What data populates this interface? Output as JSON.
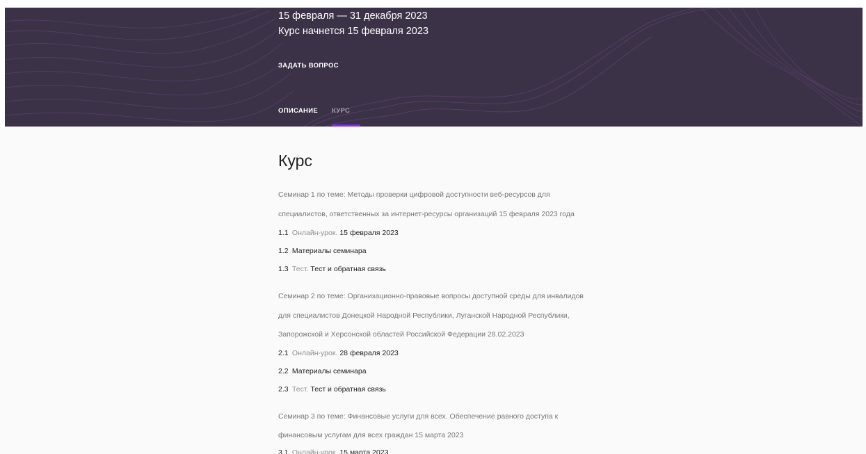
{
  "hero": {
    "dates": "15 февраля — 31 декабря 2023",
    "start": "Курс начнется 15 февраля 2023",
    "ask_label": "ЗАДАТЬ ВОПРОС",
    "tabs": [
      {
        "label": "ОПИСАНИЕ"
      },
      {
        "label": "КУРС"
      }
    ],
    "active_tab": "КУРС"
  },
  "course": {
    "heading": "Курс",
    "seminars": [
      {
        "lines": [
          "Семинар 1 по теме: Методы проверки цифровой доступности веб-ресурсов для",
          "специалистов, ответственных за интернет-ресурсы организаций 15 февраля 2023 года"
        ],
        "items": [
          {
            "num": "1.1",
            "kind": "Онлайн-урок.",
            "title": "15 февраля 2023"
          },
          {
            "num": "1.2",
            "kind": "",
            "title": "Материалы семинара"
          },
          {
            "num": "1.3",
            "kind": "Тест.",
            "title": "Тест  и обратная связь"
          }
        ]
      },
      {
        "lines": [
          "Семинар 2 по теме: Организационно-правовые вопросы доступной среды для инвалидов",
          "для специалистов Донецкой Народной Республики, Луганской Народной Республики,",
          "Запорожской и Херсонской областей Российской Федерации 28.02.2023"
        ],
        "items": [
          {
            "num": "2.1",
            "kind": "Онлайн-урок.",
            "title": "28 февраля 2023"
          },
          {
            "num": "2.2",
            "kind": "",
            "title": "Материалы семинара"
          },
          {
            "num": "2.3",
            "kind": "Тест.",
            "title": "Тест  и обратная связь"
          }
        ]
      },
      {
        "lines": [
          "Семинар 3 по теме: Финансовые услуги для всех. Обеспечение равного доступа к",
          "финансовым услугам для всех граждан 15 марта 2023"
        ],
        "items": [
          {
            "num": "3.1",
            "kind": "Онлайн-урок.",
            "title": "15 марта 2023"
          }
        ]
      }
    ]
  },
  "colors": {
    "hero_bg": "#3b3248",
    "accent": "#7b2ff7",
    "page_bg": "#fafafa"
  }
}
